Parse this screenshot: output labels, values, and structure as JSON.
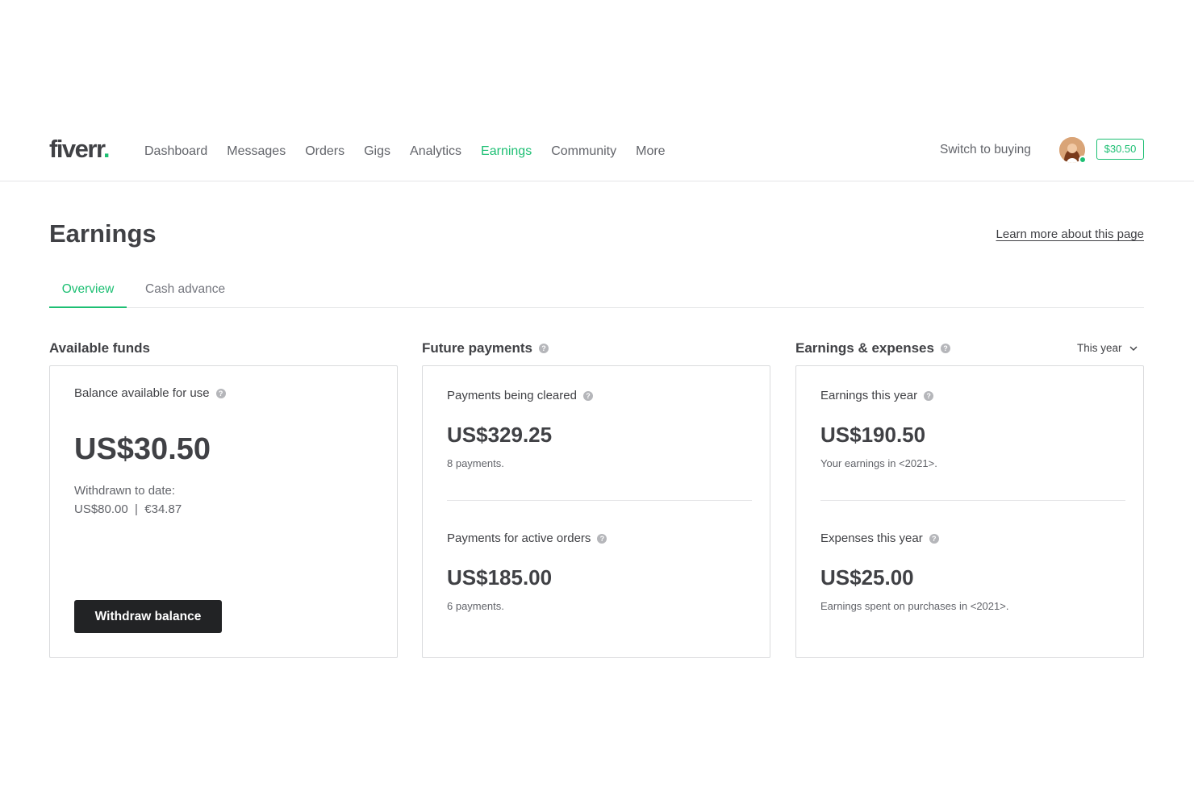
{
  "header": {
    "logo_text": "fiverr",
    "logo_dot": ".",
    "nav": [
      {
        "label": "Dashboard",
        "active": false
      },
      {
        "label": "Messages",
        "active": false
      },
      {
        "label": "Orders",
        "active": false
      },
      {
        "label": "Gigs",
        "active": false
      },
      {
        "label": "Analytics",
        "active": false
      },
      {
        "label": "Earnings",
        "active": true
      },
      {
        "label": "Community",
        "active": false
      },
      {
        "label": "More",
        "active": false
      }
    ],
    "switch_label": "Switch to buying",
    "balance_pill": "$30.50"
  },
  "page": {
    "title": "Earnings",
    "learn_more": "Learn more about this page"
  },
  "tabs": [
    {
      "label": "Overview",
      "active": true
    },
    {
      "label": "Cash advance",
      "active": false
    }
  ],
  "available_funds": {
    "title": "Available funds",
    "balance_label": "Balance available for use",
    "balance_value": "US$30.50",
    "withdrawn_label": "Withdrawn to date:",
    "withdrawn_value": "US$80.00  |  €34.87",
    "withdraw_button": "Withdraw balance"
  },
  "future_payments": {
    "title": "Future payments",
    "cleared_label": "Payments being cleared",
    "cleared_value": "US$329.25",
    "cleared_note": "8 payments.",
    "active_label": "Payments for active orders",
    "active_value": "US$185.00",
    "active_note": "6 payments."
  },
  "earnings_expenses": {
    "title": "Earnings & expenses",
    "period": "This year",
    "earnings_label": "Earnings this year",
    "earnings_value": "US$190.50",
    "earnings_note": "Your earnings in <2021>.",
    "expenses_label": "Expenses this year",
    "expenses_value": "US$25.00",
    "expenses_note": "Earnings spent on purchases in <2021>."
  },
  "colors": {
    "accent": "#1dbf73",
    "text": "#404145",
    "button_bg": "#222325"
  },
  "icons": [
    "question-icon",
    "chevron-down-icon",
    "avatar-image",
    "online-status-dot"
  ]
}
